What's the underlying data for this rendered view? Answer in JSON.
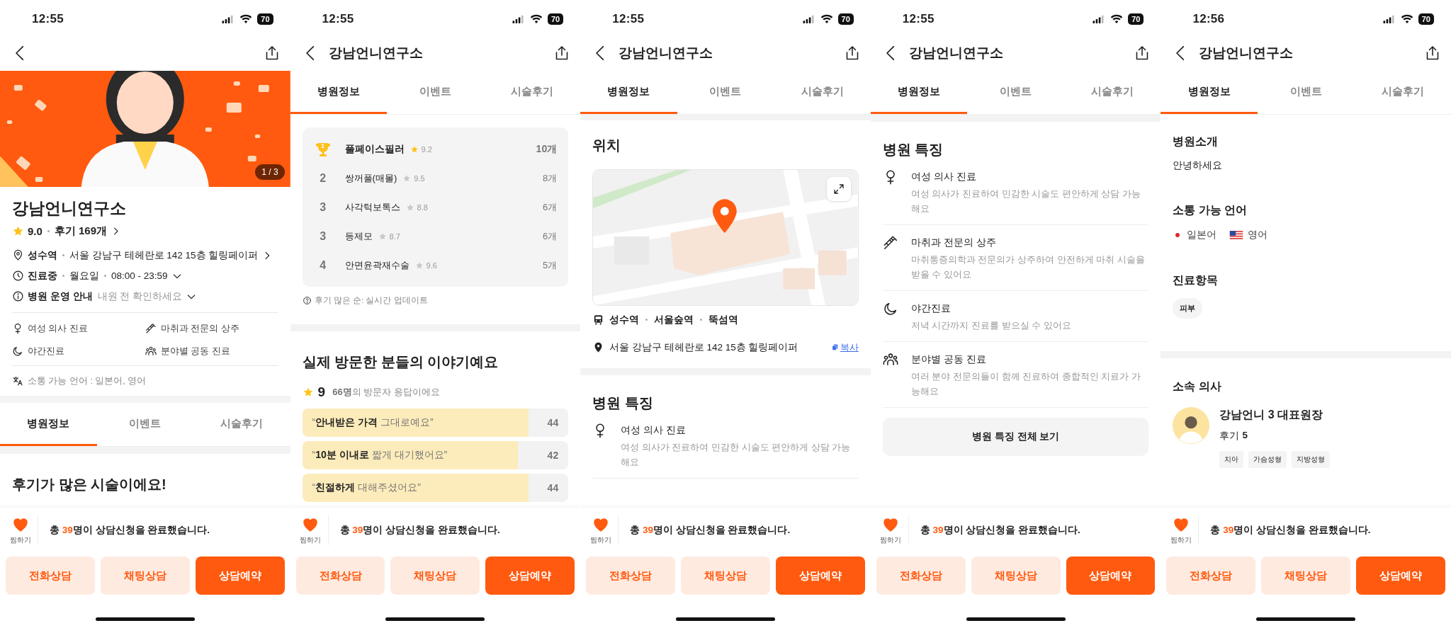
{
  "screens": [
    {
      "status": {
        "time": "12:55",
        "battery": "70"
      },
      "sections": [
        {
          "kind": "hero",
          "counter": "1 / 3"
        },
        {
          "kind": "summary",
          "name": "강남언니연구소",
          "score": "9.0",
          "reviews": "후기 169개",
          "rows": [
            {
              "kind": "location",
              "label": "성수역",
              "values": [
                "서울 강남구 테헤란로 142 15층 힐링페이퍼"
              ]
            },
            {
              "kind": "hours",
              "label": "진료중",
              "values": [
                "월요일",
                "08:00 - 23:59"
              ]
            },
            {
              "kind": "notice",
              "label": "병원 운영 안내",
              "hint": "내원 전 확인하세요"
            }
          ],
          "features": [
            {
              "kind": "female",
              "title": "여성 의사 진료"
            },
            {
              "kind": "syringe",
              "title": "마취과 전문의 상주"
            },
            {
              "kind": "moon",
              "title": "야간진료"
            },
            {
              "kind": "people",
              "title": "분야별 공동 진료"
            }
          ],
          "languages": "소통 가능 언어 : 일본어, 영어"
        },
        {
          "kind": "tabs",
          "items": [
            {
              "label": "병원정보",
              "selected": true
            },
            {
              "label": "이벤트",
              "selected": false
            },
            {
              "label": "시술후기",
              "selected": false
            }
          ]
        },
        {
          "kind": "heading",
          "text": "후기가 많은 시술이에요!"
        }
      ],
      "bottom": {
        "like": "찜하기",
        "prefix": "총 ",
        "count": "39",
        "suffix": "명이 상담신청을 완료했습니다.",
        "buttons": [
          {
            "label": "전화상담",
            "kind": "secondary"
          },
          {
            "label": "채팅상담",
            "kind": "secondary"
          },
          {
            "label": "상담예약",
            "kind": "primary"
          }
        ]
      }
    },
    {
      "status": {
        "time": "12:55",
        "battery": "70"
      },
      "header": {
        "title": "강남언니연구소"
      },
      "sections": [
        {
          "kind": "tabs",
          "items": [
            {
              "label": "병원정보",
              "selected": true
            },
            {
              "label": "이벤트",
              "selected": false
            },
            {
              "label": "시술후기",
              "selected": false
            }
          ]
        },
        {
          "kind": "ranking",
          "note": "후기 많은 순: 실시간 업데이트",
          "items": [
            {
              "rank": "1",
              "name": "풀페이스필러",
              "score": "9.2",
              "count": "10개",
              "top": true
            },
            {
              "rank": "2",
              "name": "쌍꺼풀(매몰)",
              "score": "9.5",
              "count": "8개",
              "top": false
            },
            {
              "rank": "3",
              "name": "사각턱보톡스",
              "score": "8.8",
              "count": "6개",
              "top": false
            },
            {
              "rank": "3",
              "name": "등제모",
              "score": "8.7",
              "count": "6개",
              "top": false
            },
            {
              "rank": "4",
              "name": "안면윤곽재수술",
              "score": "9.6",
              "count": "5개",
              "top": false
            }
          ]
        },
        {
          "kind": "reviews",
          "title": "실제 방문한 분들의 이야기예요",
          "score": "9",
          "summary": "**66명**의 방문자 응답이에요",
          "items": [
            {
              "text": "“**안내받은 가격** 그대로예요”",
              "count": "44",
              "level": 0.85
            },
            {
              "text": "“**10분 이내로** 짧게 대기했어요”",
              "count": "42",
              "level": 0.81
            },
            {
              "text": "“**친절하게** 대해주셨어요”",
              "count": "44",
              "level": 0.85
            }
          ]
        }
      ],
      "bottom": {
        "like": "찜하기",
        "prefix": "총 ",
        "count": "39",
        "suffix": "명이 상담신청을 완료했습니다.",
        "buttons": [
          {
            "label": "전화상담",
            "kind": "secondary"
          },
          {
            "label": "채팅상담",
            "kind": "secondary"
          },
          {
            "label": "상담예약",
            "kind": "primary"
          }
        ]
      }
    },
    {
      "status": {
        "time": "12:55",
        "battery": "70"
      },
      "header": {
        "title": "강남언니연구소"
      },
      "sections": [
        {
          "kind": "tabs",
          "items": [
            {
              "label": "병원정보",
              "selected": true
            },
            {
              "label": "이벤트",
              "selected": false
            },
            {
              "label": "시술후기",
              "selected": false
            }
          ]
        },
        {
          "kind": "location",
          "title": "위치",
          "stations": [
            "성수역",
            "서울숲역",
            "뚝섬역"
          ],
          "address": "서울 강남구 테헤란로 142 15층 힐링페이퍼",
          "copy": "복사"
        },
        {
          "kind": "features",
          "title": "병원 특징",
          "items": [
            {
              "kind": "female",
              "title": "여성 의사 진료",
              "desc": "여성 의사가 진료하여 민감한 시술도 편안하게 상담 가능해요"
            }
          ]
        }
      ],
      "bottom": {
        "like": "찜하기",
        "prefix": "총 ",
        "count": "39",
        "suffix": "명이 상담신청을 완료했습니다.",
        "buttons": [
          {
            "label": "전화상담",
            "kind": "secondary"
          },
          {
            "label": "채팅상담",
            "kind": "secondary"
          },
          {
            "label": "상담예약",
            "kind": "primary"
          }
        ]
      }
    },
    {
      "status": {
        "time": "12:55",
        "battery": "70"
      },
      "header": {
        "title": "강남언니연구소"
      },
      "sections": [
        {
          "kind": "tabs",
          "items": [
            {
              "label": "병원정보",
              "selected": true
            },
            {
              "label": "이벤트",
              "selected": false
            },
            {
              "label": "시술후기",
              "selected": false
            }
          ]
        },
        {
          "kind": "features",
          "title": "병원 특징",
          "button": "병원 특징 전체 보기",
          "items": [
            {
              "kind": "female",
              "title": "여성 의사 진료",
              "desc": "여성 의사가 진료하여 민감한 시술도 편안하게 상담 가능해요"
            },
            {
              "kind": "syringe",
              "title": "마취과 전문의 상주",
              "desc": "마취통증의학과 전문의가 상주하여 안전하게 마취 시술을 받을 수 있어요"
            },
            {
              "kind": "moon",
              "title": "야간진료",
              "desc": "저녁 시간까지 진료를 받으실 수 있어요"
            },
            {
              "kind": "people",
              "title": "분야별 공동 진료",
              "desc": "여러 분야 전문의들이 함께 진료하여 종합적인 치료가 가능해요"
            }
          ]
        }
      ],
      "bottom": {
        "like": "찜하기",
        "prefix": "총 ",
        "count": "39",
        "suffix": "명이 상담신청을 완료했습니다.",
        "buttons": [
          {
            "label": "전화상담",
            "kind": "secondary"
          },
          {
            "label": "채팅상담",
            "kind": "secondary"
          },
          {
            "label": "상담예약",
            "kind": "primary"
          }
        ]
      }
    },
    {
      "status": {
        "time": "12:56",
        "battery": "70"
      },
      "header": {
        "title": "강남언니연구소"
      },
      "sections": [
        {
          "kind": "tabs",
          "items": [
            {
              "label": "병원정보",
              "selected": true
            },
            {
              "label": "이벤트",
              "selected": false
            },
            {
              "label": "시술후기",
              "selected": false
            }
          ]
        },
        {
          "kind": "about",
          "blocks": [
            {
              "kind": "text",
              "title": "병원소개",
              "text": "안녕하세요"
            },
            {
              "kind": "languages",
              "title": "소통 가능 언어",
              "items": [
                "일본어",
                "영어"
              ]
            },
            {
              "kind": "chips",
              "title": "진료항목",
              "items": [
                "피부"
              ]
            }
          ]
        },
        {
          "kind": "doctors",
          "title": "소속 의사",
          "items": [
            {
              "name": "강남언니 3 대표원장",
              "reviews_label": "후기",
              "reviews": "5",
              "tags": [
                "치아",
                "가슴성형",
                "지방성형"
              ]
            }
          ]
        }
      ],
      "bottom": {
        "like": "찜하기",
        "prefix": "총 ",
        "count": "39",
        "suffix": "명이 상담신청을 완료했습니다.",
        "buttons": [
          {
            "label": "전화상담",
            "kind": "secondary"
          },
          {
            "label": "채팅상담",
            "kind": "secondary"
          },
          {
            "label": "상담예약",
            "kind": "primary"
          }
        ]
      }
    }
  ]
}
